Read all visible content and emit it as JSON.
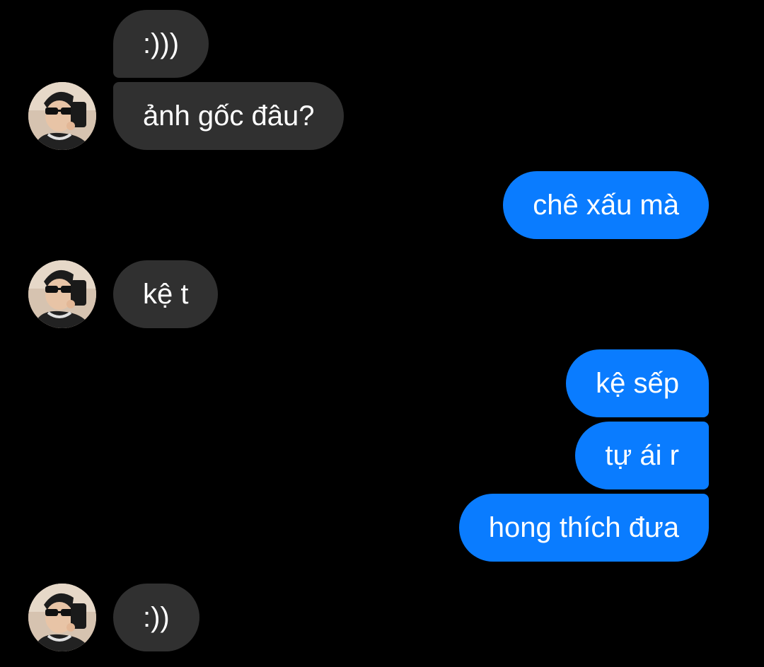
{
  "colors": {
    "background": "#000000",
    "incoming_bubble": "#303030",
    "outgoing_bubble": "#0a7cff",
    "text": "#ffffff"
  },
  "messages": [
    {
      "direction": "incoming",
      "text": ":)))"
    },
    {
      "direction": "incoming",
      "text": "ảnh gốc đâu?"
    },
    {
      "direction": "outgoing",
      "text": "chê xấu mà"
    },
    {
      "direction": "incoming",
      "text": "kệ t"
    },
    {
      "direction": "outgoing",
      "text": "kệ sếp"
    },
    {
      "direction": "outgoing",
      "text": "tự ái r"
    },
    {
      "direction": "outgoing",
      "text": "hong thích đưa"
    },
    {
      "direction": "incoming",
      "text": ":))"
    }
  ],
  "avatar": {
    "icon": "contact-avatar-photo"
  }
}
